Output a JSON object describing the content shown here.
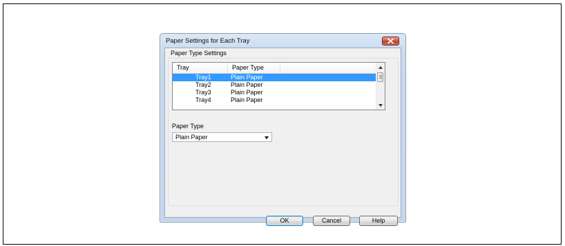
{
  "window": {
    "title": "Paper Settings for Each Tray"
  },
  "group": {
    "label": "Paper Type Settings"
  },
  "list": {
    "columns": [
      "Tray",
      "Paper Type"
    ],
    "rows": [
      {
        "tray": "Tray1",
        "paper_type": "Plain Paper",
        "selected": true
      },
      {
        "tray": "Tray2",
        "paper_type": "Plain Paper",
        "selected": false
      },
      {
        "tray": "Tray3",
        "paper_type": "Plain Paper",
        "selected": false
      },
      {
        "tray": "Tray4",
        "paper_type": "Plain Paper",
        "selected": false
      }
    ]
  },
  "paper_type": {
    "label": "Paper Type",
    "selected_value": "Plain Paper"
  },
  "buttons": {
    "ok": "OK",
    "cancel": "Cancel",
    "help": "Help"
  },
  "icons": {
    "close": "close-icon",
    "scroll_up": "chevron-up-icon",
    "scroll_down": "chevron-down-icon",
    "dropdown": "dropdown-arrow-icon"
  },
  "colors": {
    "selection": "#3399ff",
    "close_button": "#cc5a44",
    "title_bar": "#c7d9ee"
  }
}
